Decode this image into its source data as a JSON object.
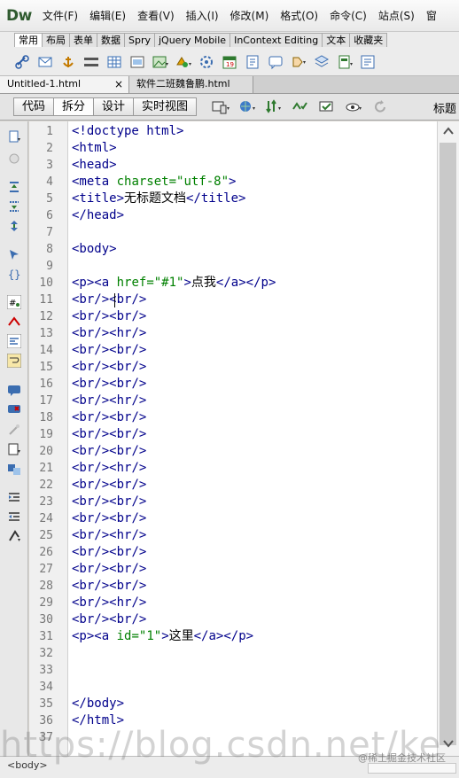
{
  "app": {
    "logo": "Dw"
  },
  "menu": [
    "文件(F)",
    "编辑(E)",
    "查看(V)",
    "插入(I)",
    "修改(M)",
    "格式(O)",
    "命令(C)",
    "站点(S)",
    "窗"
  ],
  "insert_tabs": [
    "常用",
    "布局",
    "表单",
    "数据",
    "Spry",
    "jQuery Mobile",
    "InContext Editing",
    "文本",
    "收藏夹"
  ],
  "insert_tools": [
    "hyperlink-icon",
    "email-link-icon",
    "named-anchor-icon",
    "horizontal-rule-icon",
    "table-icon",
    "insert-div-icon",
    "image-icon",
    "media-icon",
    "widget-icon",
    "date-icon",
    "server-include-icon",
    "comment-icon",
    "head-icon",
    "script-icon",
    "templates-icon",
    "tag-chooser-icon"
  ],
  "document_tabs": [
    {
      "label": "Untitled-1.html",
      "close": "×"
    },
    {
      "label": "软件二班魏鲁鹏.html"
    }
  ],
  "view_buttons": [
    "代码",
    "拆分",
    "设计",
    "实时视图"
  ],
  "active_view": "拆分",
  "doc_toolbar": {
    "title_label": "标题",
    "tools": [
      "multiscreen-icon",
      "preview-browser-icon",
      "file-management-icon",
      "w3c-validation-icon",
      "check-browser-icon",
      "visual-aids-icon",
      "refresh-icon"
    ]
  },
  "coding_toolbar": [
    "open-documents-icon",
    "show-code-navigator-icon",
    "collapse-full-tag-icon",
    "collapse-selection-icon",
    "expand-all-icon",
    "select-parent-tag-icon",
    "balance-braces-icon",
    "line-numbers-icon",
    "highlight-invalid-code-icon",
    "syntax-coloring-icon",
    "word-wrap-icon",
    "apply-comment-icon",
    "remove-comment-icon",
    "wrap-tag-icon",
    "recent-snippets-icon",
    "move-css-icon",
    "indent-code-icon",
    "outdent-code-icon",
    "format-source-icon"
  ],
  "code_lines": [
    "<!doctype html>",
    "<html>",
    "<head>",
    "<meta charset=\"utf-8\">",
    "<title>无标题文档</title>",
    "</head>",
    "",
    "<body>",
    "",
    "<p><a href=\"#1\">点我</a></p>",
    "<br/><br/>",
    "<br/><br/>",
    "<br/><hr/>",
    "<br/><br/>",
    "<br/><br/>",
    "<br/><br/>",
    "<br/><hr/>",
    "<br/><br/>",
    "<br/><br/>",
    "<br/><br/>",
    "<br/><hr/>",
    "<br/><br/>",
    "<br/><br/>",
    "<br/><br/>",
    "<br/><hr/>",
    "<br/><br/>",
    "<br/><br/>",
    "<br/><br/>",
    "<br/><hr/>",
    "<br/><br/>",
    "<p><a id=\"1\">这里</a></p>",
    "",
    "",
    "",
    "</body>",
    "</html>",
    ""
  ],
  "status": {
    "tag": "<body>"
  },
  "watermarks": {
    "url": "https://blog.csdn.net/ke",
    "juejin": "@稀土掘金技术社区"
  },
  "colors": {
    "tag": "#00008b",
    "attribute": "#008000",
    "text": "#000000",
    "gutter": "#f0f0f0"
  }
}
